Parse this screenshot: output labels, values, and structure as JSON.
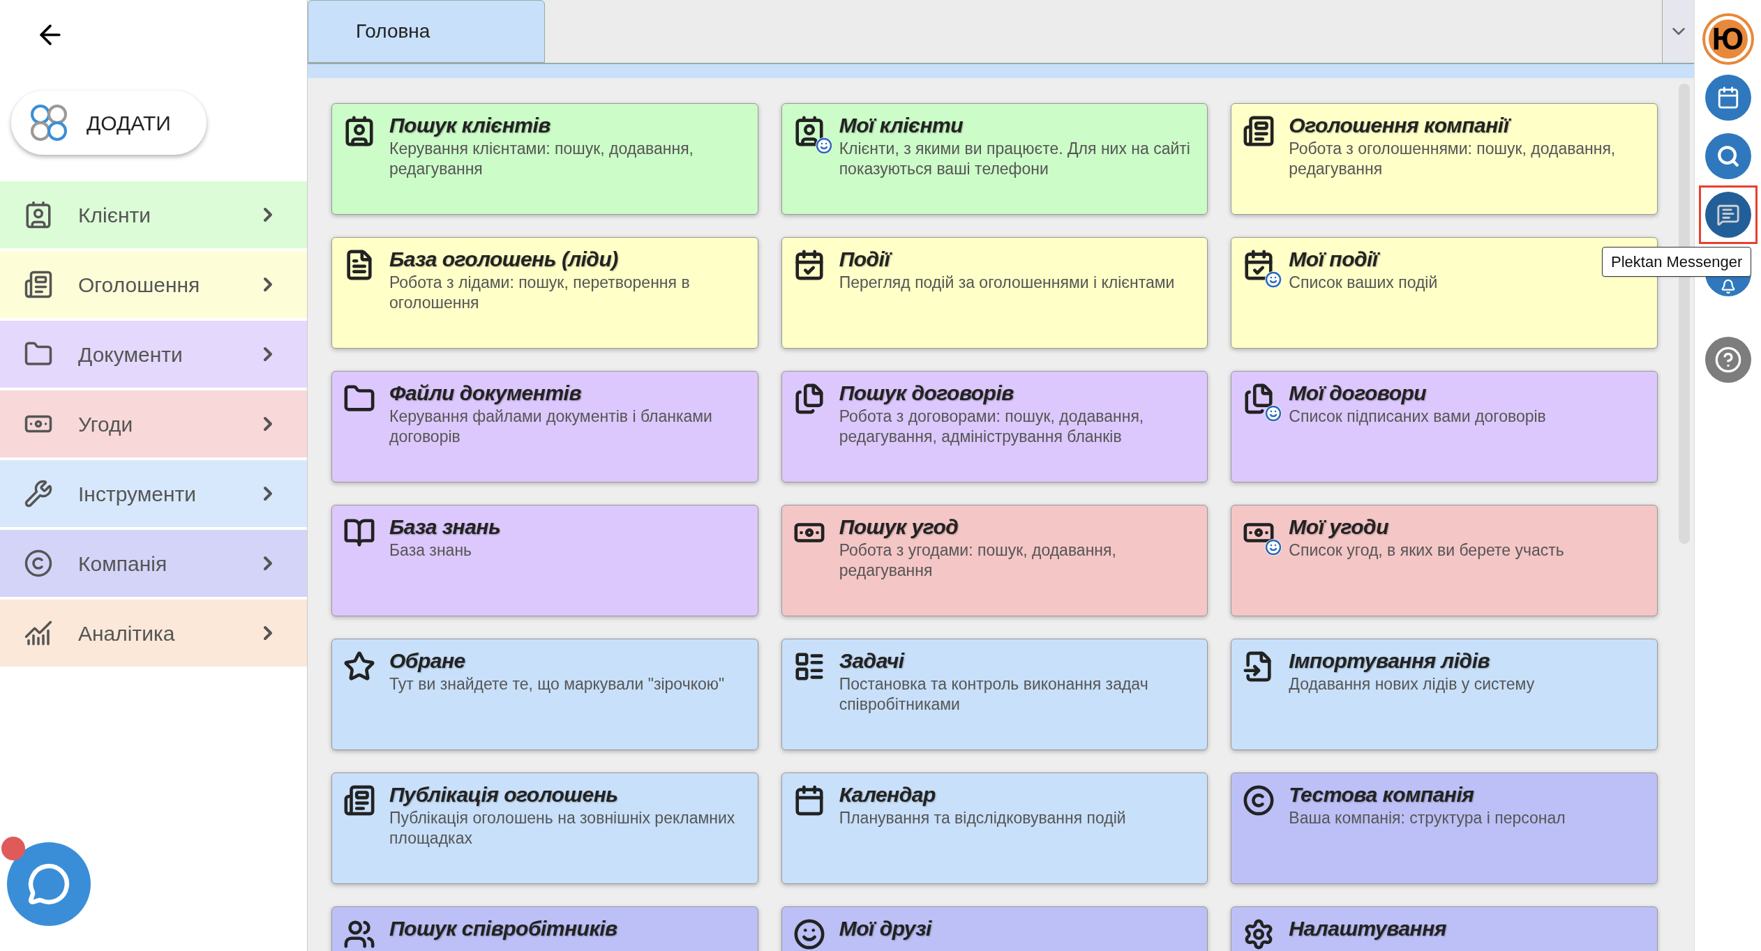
{
  "add_button": {
    "label": "ДОДАТИ"
  },
  "sidebar": {
    "items": [
      {
        "label": "Клієнти",
        "color": "#dcfcd8"
      },
      {
        "label": "Оголошення",
        "color": "#fdfdd8"
      },
      {
        "label": "Документи",
        "color": "#e4d8fc"
      },
      {
        "label": "Угоди",
        "color": "#f8d8d8"
      },
      {
        "label": "Інструменти",
        "color": "#d8e8fc"
      },
      {
        "label": "Компанія",
        "color": "#d4d4f8"
      },
      {
        "label": "Аналітика",
        "color": "#fbe8d8"
      }
    ]
  },
  "tabs": [
    {
      "label": "Головна",
      "selected": true
    }
  ],
  "cards": [
    {
      "title": "Пошук клієнтів",
      "description": "Керування клієнтами: пошук, додавання, редагування",
      "color": "#ccfcc8"
    },
    {
      "title": "Мої клієнти",
      "description": "Клієнти, з якими ви працюєте. Для них на сайті показуються ваші телефони",
      "color": "#ccfcc8"
    },
    {
      "title": "Оголошення компанії",
      "description": "Робота з оголошеннями: пошук, додавання, редагування",
      "color": "#ffffc8"
    },
    {
      "title": "База оголошень (ліди)",
      "description": "Робота з лідами: пошук, перетворення в оголошення",
      "color": "#ffffc8"
    },
    {
      "title": "Події",
      "description": "Перегляд подій за оголошеннями і клієнтами",
      "color": "#ffffc8"
    },
    {
      "title": "Мої події",
      "description": "Список ваших подій",
      "color": "#ffffc8"
    },
    {
      "title": "Файли документів",
      "description": "Керування файлами документів і бланками договорів",
      "color": "#dcc8fc"
    },
    {
      "title": "Пошук договорів",
      "description": "Робота з договорами: пошук, додавання, редагування, адміністрування бланків",
      "color": "#dcc8fc"
    },
    {
      "title": "Мої договори",
      "description": "Список підписаних вами договорів",
      "color": "#dcc8fc"
    },
    {
      "title": "База знань",
      "description": "База знань",
      "color": "#dcc8fc"
    },
    {
      "title": "Пошук угод",
      "description": "Робота з угодами: пошук, додавання, редагування",
      "color": "#f5c6c6"
    },
    {
      "title": "Мої угоди",
      "description": "Список угод, в яких ви берете участь",
      "color": "#f5c6c6"
    },
    {
      "title": "Обране",
      "description": "Тут ви знайдете те, що маркували \"зірочкою\"",
      "color": "#c8e0fa"
    },
    {
      "title": "Задачі",
      "description": "Постановка та контроль виконання задач співробітниками",
      "color": "#c8e0fa"
    },
    {
      "title": "Імпортування лідів",
      "description": "Додавання нових лідів у систему",
      "color": "#c8e0fa"
    },
    {
      "title": "Публікація оголошень",
      "description": "Публікація оголошень на зовнішніх рекламних площадках",
      "color": "#c8e0fa"
    },
    {
      "title": "Календар",
      "description": "Планування та відслідковування подій",
      "color": "#c8e0fa"
    },
    {
      "title": "Тестова компанія",
      "description": "Ваша компанія: структура і персонал",
      "color": "#bcc0f6"
    },
    {
      "title": "Пошук співробітників",
      "color": "#bcc0f6"
    },
    {
      "title": "Мої друзі",
      "color": "#bcc0f6"
    },
    {
      "title": "Налаштування",
      "color": "#bcc0f6"
    }
  ],
  "right_rail": {
    "buttons": [
      {
        "kind": "avatar",
        "label": "Ю",
        "highlighted": false
      },
      {
        "kind": "calendar",
        "highlighted": false
      },
      {
        "kind": "search",
        "highlighted": false
      },
      {
        "kind": "messenger",
        "highlighted": true
      },
      {
        "kind": "notifications",
        "highlighted": false
      },
      {
        "kind": "help",
        "highlighted": false
      }
    ],
    "tooltip": "Plektan Messenger"
  },
  "chat_widget": {
    "unread": true
  }
}
